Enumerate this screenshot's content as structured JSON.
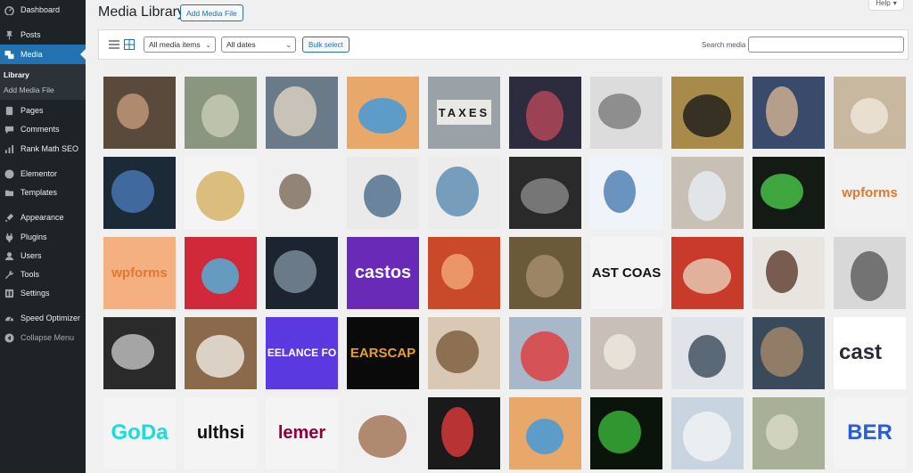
{
  "sidebar": {
    "items": [
      {
        "label": "Dashboard",
        "icon": "dashboard-icon",
        "active": false
      },
      {
        "label": "Posts",
        "icon": "pin-icon",
        "active": false
      },
      {
        "label": "Media",
        "icon": "media-icon",
        "active": true
      },
      {
        "label": "Pages",
        "icon": "pages-icon",
        "active": false
      },
      {
        "label": "Comments",
        "icon": "comment-icon",
        "active": false
      },
      {
        "label": "Rank Math SEO",
        "icon": "rankmath-icon",
        "active": false
      },
      {
        "label": "Elementor",
        "icon": "elementor-icon",
        "active": false
      },
      {
        "label": "Templates",
        "icon": "folder-icon",
        "active": false
      },
      {
        "label": "Appearance",
        "icon": "brush-icon",
        "active": false
      },
      {
        "label": "Plugins",
        "icon": "plugin-icon",
        "active": false
      },
      {
        "label": "Users",
        "icon": "user-icon",
        "active": false
      },
      {
        "label": "Tools",
        "icon": "wrench-icon",
        "active": false
      },
      {
        "label": "Settings",
        "icon": "settings-icon",
        "active": false
      },
      {
        "label": "Speed Optimizer",
        "icon": "speed-icon",
        "active": false
      }
    ],
    "submenu": [
      "Library",
      "Add Media File"
    ],
    "collapse_label": "Collapse Menu"
  },
  "header": {
    "title": "Media Library",
    "add_button": "Add Media File",
    "help": "Help"
  },
  "toolbar": {
    "filter_type": "All media items",
    "filter_date": "All dates",
    "bulk_select": "Bulk select",
    "search_label": "Search media",
    "search_value": ""
  },
  "media_tiles": [
    {
      "desc": "portrait-man",
      "bg": "#5a4a3c",
      "fg": "#c49a7a",
      "caption": ""
    },
    {
      "desc": "dollar-bills",
      "bg": "#8a9680",
      "fg": "#c9cdb8",
      "caption": ""
    },
    {
      "desc": "couple-paperwork",
      "bg": "#6b7a88",
      "fg": "#e0d4c4",
      "caption": ""
    },
    {
      "desc": "blue-piggy-bank",
      "bg": "#e8a86a",
      "fg": "#3a98e0",
      "caption": ""
    },
    {
      "desc": "taxes-lightbox",
      "bg": "#9aa2a8",
      "fg": "#e8e8e4",
      "caption": "TAXES"
    },
    {
      "desc": "stock-chart-pen",
      "bg": "#2c2c3e",
      "fg": "#b84a5a",
      "caption": ""
    },
    {
      "desc": "magnifier-chart",
      "bg": "#dcdcdc",
      "fg": "#7a7a7a",
      "caption": ""
    },
    {
      "desc": "tablet-chart",
      "bg": "#a88a4a",
      "fg": "#1a1a1a",
      "caption": ""
    },
    {
      "desc": "man-laptop",
      "bg": "#3a4a6a",
      "fg": "#d4b494",
      "caption": ""
    },
    {
      "desc": "senior-couple",
      "bg": "#c8b8a0",
      "fg": "#f0e8dc",
      "caption": ""
    },
    {
      "desc": "dark-stock-chart",
      "bg": "#1c2a38",
      "fg": "#4a7ab8",
      "caption": ""
    },
    {
      "desc": "web-page-people",
      "bg": "#f4f4f4",
      "fg": "#d4b060",
      "caption": ""
    },
    {
      "desc": "web-page-grid",
      "bg": "#f0f0f0",
      "fg": "#7a6a5a",
      "caption": ""
    },
    {
      "desc": "web-page-cars",
      "bg": "#eaeaea",
      "fg": "#4a6a8a",
      "caption": ""
    },
    {
      "desc": "web-page-travel",
      "bg": "#ececec",
      "fg": "#5a8ab0",
      "caption": ""
    },
    {
      "desc": "dark-web-page",
      "bg": "#2a2a2a",
      "fg": "#8a8a8a",
      "caption": ""
    },
    {
      "desc": "web-page-products",
      "bg": "#eef4fa",
      "fg": "#4a7ab0",
      "caption": ""
    },
    {
      "desc": "laptop-desk",
      "bg": "#c8c0b4",
      "fg": "#e8eef4",
      "caption": ""
    },
    {
      "desc": "code-screen",
      "bg": "#141a14",
      "fg": "#4ac84a",
      "caption": ""
    },
    {
      "desc": "wpforms-logo",
      "bg": "#f2f2f2",
      "fg": "#e27730",
      "caption": "wpforms"
    },
    {
      "desc": "wpforms-orange",
      "bg": "#f4b080",
      "fg": "#e27730",
      "caption": "wpforms"
    },
    {
      "desc": "colorful-blocks",
      "bg": "#d02a3a",
      "fg": "#4ab8e0",
      "caption": ""
    },
    {
      "desc": "mountain-night",
      "bg": "#1c2430",
      "fg": "#8090a0",
      "caption": ""
    },
    {
      "desc": "castos-purple",
      "bg": "#6a2ab8",
      "fg": "#ffffff",
      "caption": "castos"
    },
    {
      "desc": "red-illustration",
      "bg": "#c84a28",
      "fg": "#f4a878",
      "caption": ""
    },
    {
      "desc": "old-wheel",
      "bg": "#6a5a3a",
      "fg": "#a89070",
      "caption": ""
    },
    {
      "desc": "east-coast-terpenes",
      "bg": "#f4f4f4",
      "fg": "#111111",
      "caption": "AST COAS"
    },
    {
      "desc": "man-red-wall",
      "bg": "#c83a2a",
      "fg": "#e8d0b8",
      "caption": ""
    },
    {
      "desc": "woman-smiling",
      "bg": "#e8e4e0",
      "fg": "#5a3a2a",
      "caption": ""
    },
    {
      "desc": "document-pen",
      "bg": "#d8d8d8",
      "fg": "#5a5a5a",
      "caption": ""
    },
    {
      "desc": "video-call-laptop",
      "bg": "#2a2a2a",
      "fg": "#c4c4c4",
      "caption": ""
    },
    {
      "desc": "desk-notebook",
      "bg": "#8a6a4a",
      "fg": "#f0ebe4",
      "caption": ""
    },
    {
      "desc": "freelance-logo",
      "bg": "#5a3ae0",
      "fg": "#ffffff",
      "caption": "EELANCE FO"
    },
    {
      "desc": "earscape-logo",
      "bg": "#0a0a0a",
      "fg": "#e8a020",
      "caption": "EARSCAP"
    },
    {
      "desc": "podcast-studio",
      "bg": "#d8c8b4",
      "fg": "#7a5a3a",
      "caption": ""
    },
    {
      "desc": "board-game-pieces",
      "bg": "#a8b8c8",
      "fg": "#e03a3a",
      "caption": ""
    },
    {
      "desc": "tutor-student",
      "bg": "#c8c0b8",
      "fg": "#f0e8e0",
      "caption": ""
    },
    {
      "desc": "man-whiteboard",
      "bg": "#e0e4e8",
      "fg": "#3a4a5a",
      "caption": ""
    },
    {
      "desc": "excited-woman",
      "bg": "#3a4a5a",
      "fg": "#a88a6a",
      "caption": ""
    },
    {
      "desc": "castos-white",
      "bg": "#ffffff",
      "fg": "#2a2a3a",
      "caption": "cast"
    },
    {
      "desc": "godaddy-logo",
      "bg": "#f4f4f4",
      "fg": "#1bdbdb",
      "caption": "GoDa"
    },
    {
      "desc": "healthsite-logo",
      "bg": "#f4f4f4",
      "fg": "#111111",
      "caption": "ulthsi"
    },
    {
      "desc": "elementor-logo",
      "bg": "#f4f4f4",
      "fg": "#92003b",
      "caption": "lemer"
    },
    {
      "desc": "support-agent",
      "bg": "#f0f0f0",
      "fg": "#a07050",
      "caption": ""
    },
    {
      "desc": "stock-board",
      "bg": "#1a1a1a",
      "fg": "#e03a3a",
      "caption": ""
    },
    {
      "desc": "piggy-bank-coins",
      "bg": "#e8a86a",
      "fg": "#3a98e0",
      "caption": ""
    },
    {
      "desc": "green-chart-dark",
      "bg": "#0a140a",
      "fg": "#3ab83a",
      "caption": ""
    },
    {
      "desc": "calculator-docs",
      "bg": "#c8d4e0",
      "fg": "#f4f4f4",
      "caption": ""
    },
    {
      "desc": "dollar-bills-2",
      "bg": "#a8b098",
      "fg": "#dcdcc8",
      "caption": ""
    },
    {
      "desc": "blue-logo",
      "bg": "#f4f4f4",
      "fg": "#2a5ae0",
      "caption": "BER"
    }
  ]
}
